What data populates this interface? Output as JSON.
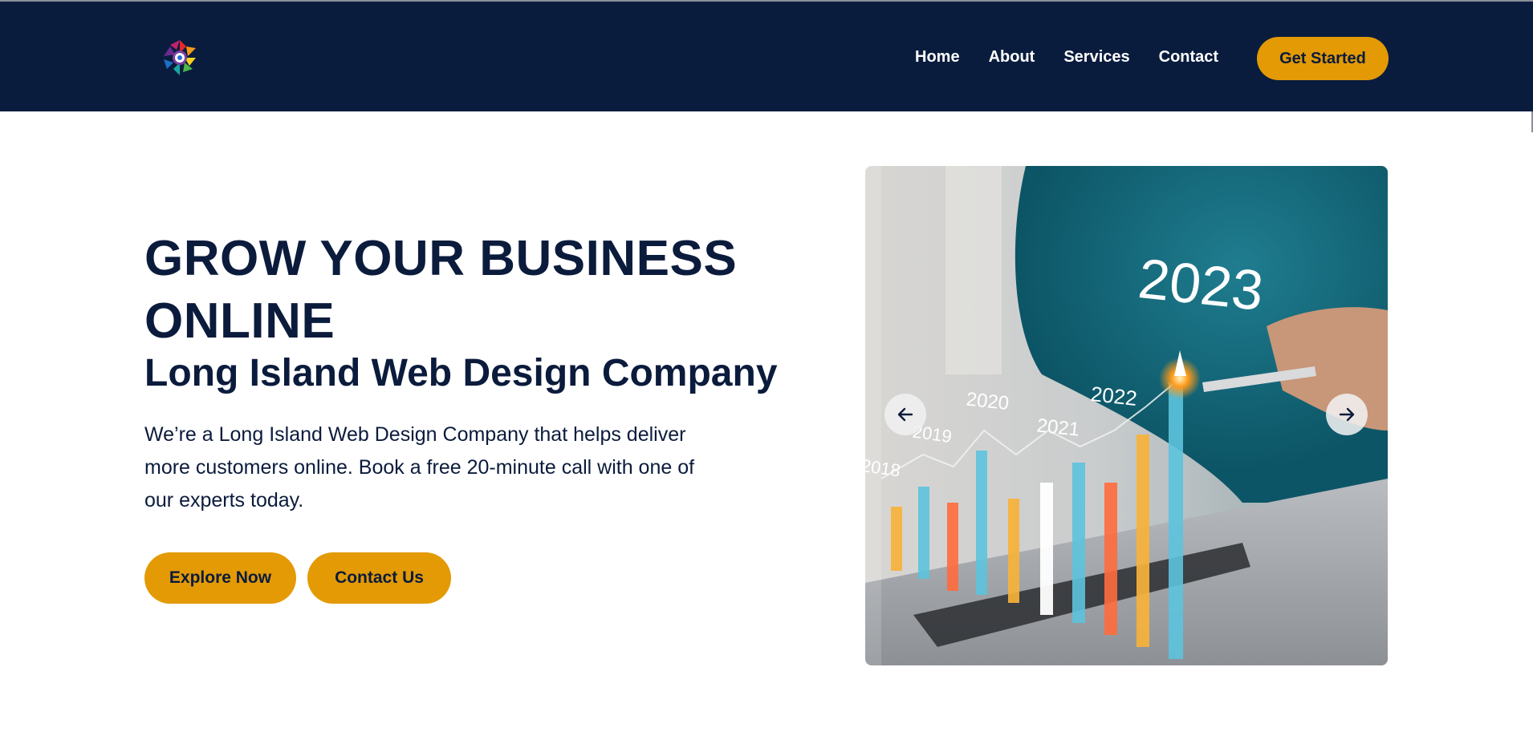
{
  "nav": {
    "items": [
      {
        "label": "Home"
      },
      {
        "label": "About"
      },
      {
        "label": "Services"
      },
      {
        "label": "Contact"
      }
    ],
    "cta_label": "Get Started"
  },
  "hero": {
    "title": "GROW YOUR BUSINESS ONLINE",
    "subtitle": "Long Island Web Design Company",
    "description": "We’re a Long Island Web Design Company that helps deliver more customers online. Book a free 20-minute call with one of our experts today.",
    "primary_button": "Explore Now",
    "secondary_button": "Contact Us"
  },
  "slider": {
    "image_labels": {
      "big_year": "2023",
      "years": [
        "2018",
        "2019",
        "2020",
        "2021",
        "2022"
      ]
    },
    "prev_icon": "arrow-left-icon",
    "next_icon": "arrow-right-icon"
  },
  "colors": {
    "header_bg": "#0a1c3e",
    "accent": "#e39a05",
    "text_dark": "#0b1b3c"
  }
}
